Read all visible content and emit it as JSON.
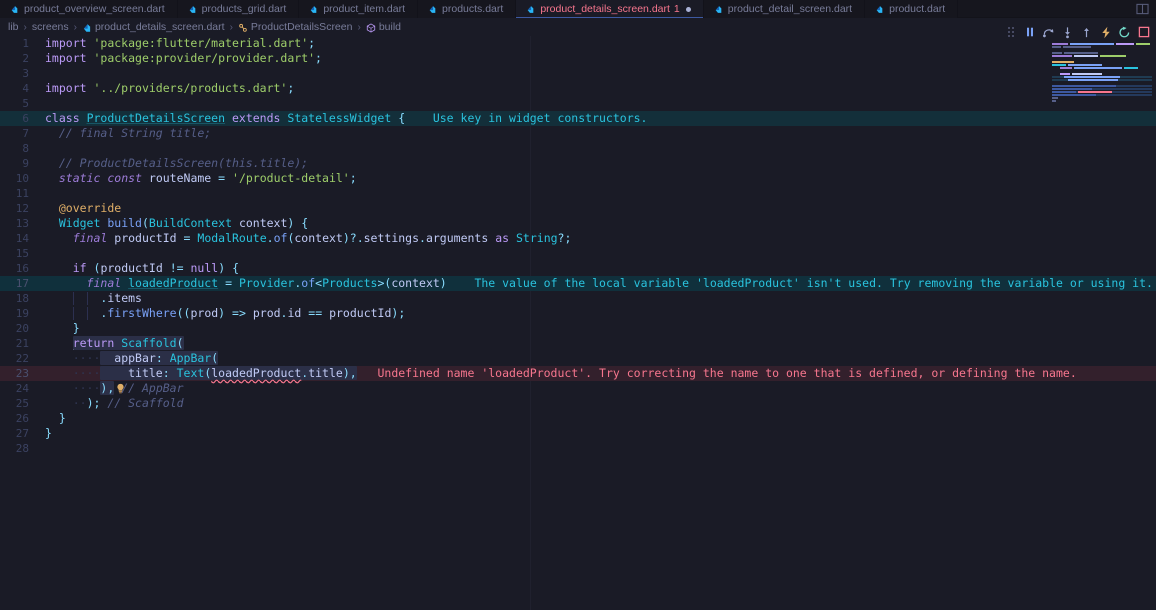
{
  "window": {
    "background": "#1a1b26",
    "accent": "#7aa2f7",
    "error_color": "#f7768e",
    "warning_color": "#2ac3de"
  },
  "tabs": [
    {
      "label": "product_overview_screen.dart",
      "icon": "dart-file-icon",
      "active": false
    },
    {
      "label": "products_grid.dart",
      "icon": "dart-file-icon",
      "active": false
    },
    {
      "label": "product_item.dart",
      "icon": "dart-file-icon",
      "active": false
    },
    {
      "label": "products.dart",
      "icon": "dart-file-icon",
      "active": false
    },
    {
      "label": "product_details_screen.dart",
      "icon": "dart-file-icon",
      "active": true,
      "problem_count": "1",
      "modified": true
    },
    {
      "label": "product_detail_screen.dart",
      "icon": "dart-file-icon",
      "active": false
    },
    {
      "label": "product.dart",
      "icon": "dart-file-icon",
      "active": false
    }
  ],
  "tabbar_actions": [
    {
      "name": "split-editor-icon",
      "title": "Split Editor"
    }
  ],
  "breadcrumb": [
    {
      "label": "lib",
      "icon": null
    },
    {
      "label": "screens",
      "icon": null
    },
    {
      "label": "product_details_screen.dart",
      "icon": "dart-file-icon"
    },
    {
      "label": "ProductDetailsScreen",
      "icon": "class-icon"
    },
    {
      "label": "build",
      "icon": "method-icon"
    }
  ],
  "debug_toolbar": [
    {
      "name": "drag-handle-icon",
      "label": "Drag"
    },
    {
      "name": "pause-icon",
      "label": "Pause",
      "color": "#7aa2f7"
    },
    {
      "name": "step-over-icon",
      "label": "Step Over",
      "color": "#9aa5ce"
    },
    {
      "name": "step-into-icon",
      "label": "Step Into",
      "color": "#9aa5ce"
    },
    {
      "name": "step-out-icon",
      "label": "Step Out",
      "color": "#9aa5ce"
    },
    {
      "name": "hot-reload-icon",
      "label": "Hot Reload",
      "color": "#e0af68"
    },
    {
      "name": "hot-restart-icon",
      "label": "Hot Restart",
      "color": "#73daca"
    },
    {
      "name": "stop-icon",
      "label": "Stop",
      "color": "#f7768e"
    }
  ],
  "editor": {
    "first_line": 1,
    "last_line": 28,
    "cursor_line": 21,
    "language": "dart",
    "inlay_hints": [
      {
        "line": 6,
        "kind": "hint",
        "text": "Use key in widget constructors."
      },
      {
        "line": 17,
        "kind": "warning",
        "text": "The value of the local variable 'loadedProduct' isn't used. Try removing the variable or using it."
      },
      {
        "line": 23,
        "kind": "error",
        "text": "Undefined name 'loadedProduct'. Try correcting the name to one that is defined, or defining the name."
      }
    ],
    "lines": [
      {
        "n": 1,
        "text": "import 'package:flutter/material.dart';"
      },
      {
        "n": 2,
        "text": "import 'package:provider/provider.dart';"
      },
      {
        "n": 3,
        "text": ""
      },
      {
        "n": 4,
        "text": "import '../providers/products.dart';"
      },
      {
        "n": 5,
        "text": ""
      },
      {
        "n": 6,
        "text": "class ProductDetailsScreen extends StatelessWidget {"
      },
      {
        "n": 7,
        "text": "  // final String title;"
      },
      {
        "n": 8,
        "text": ""
      },
      {
        "n": 9,
        "text": "  // ProductDetailsScreen(this.title);"
      },
      {
        "n": 10,
        "text": "  static const routeName = '/product-detail';"
      },
      {
        "n": 11,
        "text": ""
      },
      {
        "n": 12,
        "text": "  @override"
      },
      {
        "n": 13,
        "text": "  Widget build(BuildContext context) {"
      },
      {
        "n": 14,
        "text": "    final productId = ModalRoute.of(context)?.settings.arguments as String?;"
      },
      {
        "n": 15,
        "text": ""
      },
      {
        "n": 16,
        "text": "    if (productId != null) {"
      },
      {
        "n": 17,
        "text": "      final loadedProduct = Provider.of<Products>(context)"
      },
      {
        "n": 18,
        "text": "          .items"
      },
      {
        "n": 19,
        "text": "          .firstWhere((prod) => prod.id == productId);"
      },
      {
        "n": 20,
        "text": "    }"
      },
      {
        "n": 21,
        "text": "    return Scaffold("
      },
      {
        "n": 22,
        "text": "      appBar: AppBar("
      },
      {
        "n": 23,
        "text": "        title: Text(loadedProduct.title),"
      },
      {
        "n": 24,
        "text": "      ), // AppBar"
      },
      {
        "n": 25,
        "text": "    ); // Scaffold"
      },
      {
        "n": 26,
        "text": "  }"
      },
      {
        "n": 27,
        "text": "}"
      },
      {
        "n": 28,
        "text": ""
      }
    ]
  },
  "minimap": {
    "name": "code-minimap",
    "visible": true
  }
}
